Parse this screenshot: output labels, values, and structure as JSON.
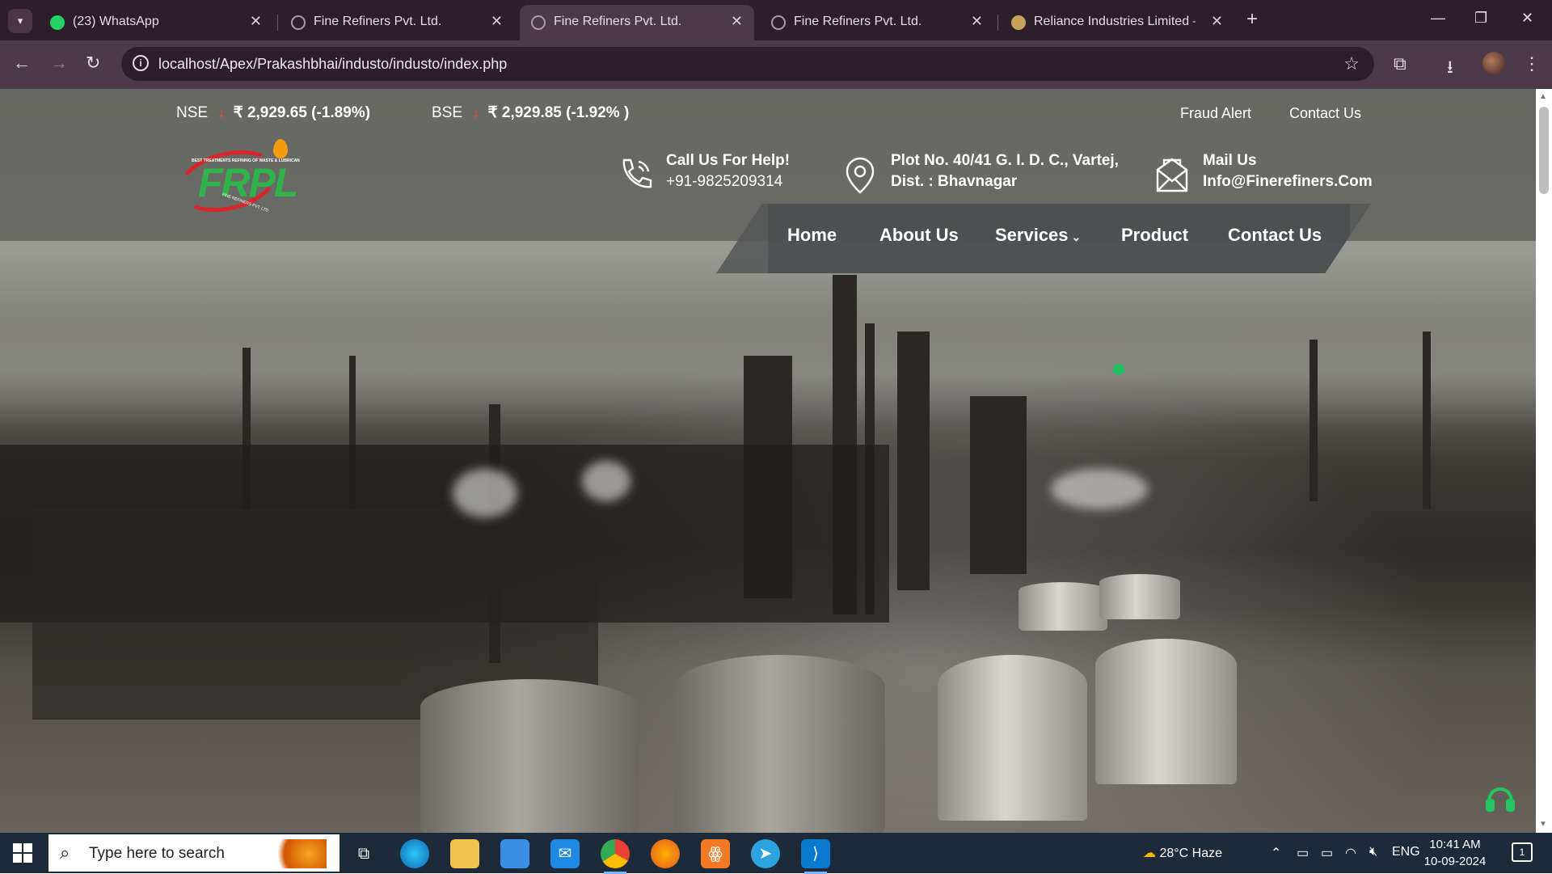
{
  "browser": {
    "tabs": [
      {
        "title": "(23) WhatsApp",
        "icon": "whatsapp-icon",
        "active": false
      },
      {
        "title": "Fine Refiners Pvt. Ltd.",
        "icon": "globe-icon",
        "active": false
      },
      {
        "title": "Fine Refiners Pvt. Ltd.",
        "icon": "globe-icon",
        "active": true
      },
      {
        "title": "Fine Refiners Pvt. Ltd.",
        "icon": "globe-icon",
        "active": false
      },
      {
        "title": "Reliance Industries Limited – Pe",
        "icon": "reliance-icon",
        "active": false
      }
    ],
    "url": "localhost/Apex/Prakashbhai/industo/industo/index.php"
  },
  "site": {
    "ticker": {
      "nse_label": "NSE",
      "nse_value": "₹ 2,929.65 (-1.89%)",
      "bse_label": "BSE",
      "bse_value": "₹ 2,929.85 (-1.92% )"
    },
    "top_links": {
      "fraud_alert": "Fraud Alert",
      "contact_us": "Contact Us"
    },
    "logo": {
      "text": "FRPL",
      "tagline": "BEST TREATMENTS REFINING OF WASTE & LUBRICAN",
      "sub": "FINE REFINERS PVT. LTD."
    },
    "call": {
      "title": "Call Us For Help!",
      "value": "+91-9825209314"
    },
    "address": {
      "line1": "Plot No. 40/41 G. I. D. C., Vartej,",
      "line2": "Dist. : Bhavnagar"
    },
    "mail": {
      "title": "Mail Us",
      "value": "Info@Finerefiners.Com"
    },
    "nav": {
      "home": "Home",
      "about": "About Us",
      "services": "Services",
      "product": "Product",
      "contact": "Contact Us"
    }
  },
  "taskbar": {
    "search_placeholder": "Type here to search",
    "weather": "28°C  Haze",
    "lang": "ENG",
    "time": "10:41 AM",
    "date": "10-09-2024",
    "notifications": "1"
  },
  "colors": {
    "ticker_down": "#e74c3c",
    "logo_green": "#2fb34a",
    "logo_red": "#d9262b",
    "accent_green": "#22c55e"
  }
}
